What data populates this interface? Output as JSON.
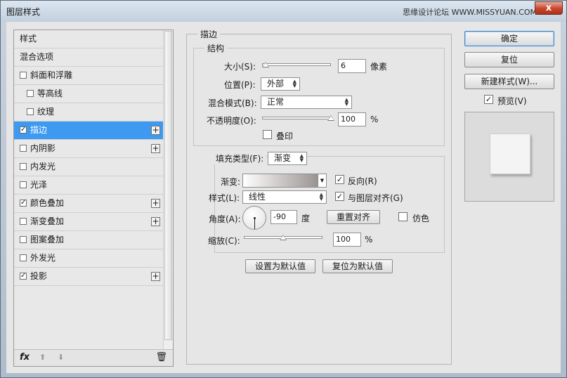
{
  "window": {
    "title": "图层样式",
    "watermark": "思缘设计论坛 WWW.MISSYUAN.COM",
    "close_glyph": "x"
  },
  "style_list": {
    "items": [
      {
        "label": "样式",
        "checkbox": false,
        "checked": false,
        "plus": false,
        "indent": false,
        "selected": false
      },
      {
        "label": "混合选项",
        "checkbox": false,
        "checked": false,
        "plus": false,
        "indent": false,
        "selected": false
      },
      {
        "label": "斜面和浮雕",
        "checkbox": true,
        "checked": false,
        "plus": false,
        "indent": false,
        "selected": false
      },
      {
        "label": "等高线",
        "checkbox": true,
        "checked": false,
        "plus": false,
        "indent": true,
        "selected": false
      },
      {
        "label": "纹理",
        "checkbox": true,
        "checked": false,
        "plus": false,
        "indent": true,
        "selected": false
      },
      {
        "label": "描边",
        "checkbox": true,
        "checked": true,
        "plus": true,
        "indent": false,
        "selected": true
      },
      {
        "label": "内阴影",
        "checkbox": true,
        "checked": false,
        "plus": true,
        "indent": false,
        "selected": false
      },
      {
        "label": "内发光",
        "checkbox": true,
        "checked": false,
        "plus": false,
        "indent": false,
        "selected": false
      },
      {
        "label": "光泽",
        "checkbox": true,
        "checked": false,
        "plus": false,
        "indent": false,
        "selected": false
      },
      {
        "label": "颜色叠加",
        "checkbox": true,
        "checked": true,
        "plus": true,
        "indent": false,
        "selected": false
      },
      {
        "label": "渐变叠加",
        "checkbox": true,
        "checked": false,
        "plus": true,
        "indent": false,
        "selected": false
      },
      {
        "label": "图案叠加",
        "checkbox": true,
        "checked": false,
        "plus": false,
        "indent": false,
        "selected": false
      },
      {
        "label": "外发光",
        "checkbox": true,
        "checked": false,
        "plus": false,
        "indent": false,
        "selected": false
      },
      {
        "label": "投影",
        "checkbox": true,
        "checked": true,
        "plus": true,
        "indent": false,
        "selected": false
      }
    ],
    "footer": {
      "fx_label": "fx",
      "up_glyph": "⬆",
      "down_glyph": "⬇",
      "trash_glyph": "🗑"
    },
    "check_glyph": "✓",
    "plus_glyph": "+"
  },
  "stroke": {
    "section_title": "描边",
    "structure": {
      "title": "结构",
      "size_label": "大小(S):",
      "size_value": "6",
      "size_unit": "像素",
      "size_level": 0.05,
      "position_label": "位置(P):",
      "position_value": "外部",
      "blend_label": "混合模式(B):",
      "blend_value": "正常",
      "opacity_label": "不透明度(O):",
      "opacity_value": "100",
      "opacity_unit": "%",
      "opacity_level": 1.0,
      "overprint_label": "叠印",
      "overprint_checked": false
    },
    "fill": {
      "fill_type_label": "填充类型(F):",
      "fill_type_value": "渐变",
      "gradient_label": "渐变:",
      "reverse_label": "反向(R)",
      "reverse_checked": true,
      "style_label": "样式(L):",
      "style_value": "线性",
      "align_label": "与图层对齐(G)",
      "align_checked": true,
      "angle_label": "角度(A):",
      "angle_value": "-90",
      "angle_unit": "度",
      "reset_align_label": "重置对齐",
      "dither_label": "仿色",
      "dither_checked": false,
      "scale_label": "缩放(C):",
      "scale_value": "100",
      "scale_unit": "%",
      "scale_level": 0.5
    },
    "set_default_label": "设置为默认值",
    "reset_default_label": "复位为默认值"
  },
  "actions": {
    "ok_label": "确定",
    "reset_label": "复位",
    "new_style_label": "新建样式(W)...",
    "preview_label": "预览(V)",
    "preview_checked": true
  },
  "colors": {
    "selection": "#3d9af0",
    "dialog_bg": "#e6e6e6"
  }
}
